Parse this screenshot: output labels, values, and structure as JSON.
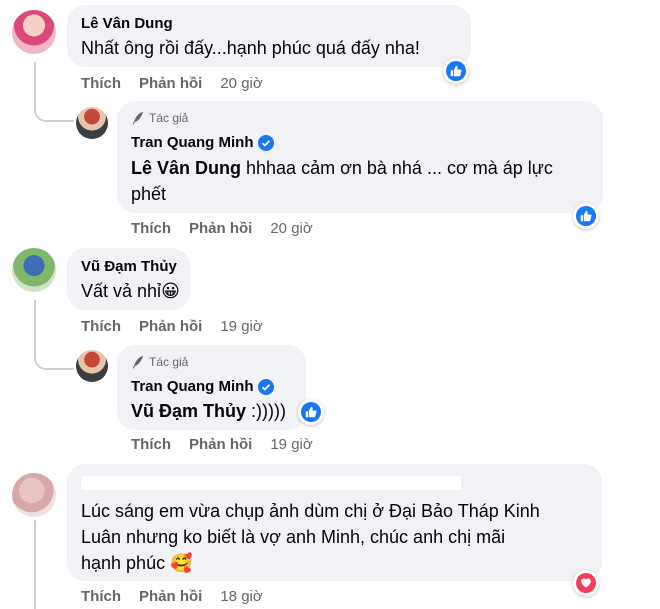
{
  "comments": [
    {
      "author": "Lê Vân Dung",
      "text": "Nhất ông rồi đấy...hạnh phúc quá đấy nha!",
      "like_label": "Thích",
      "reply_label": "Phản hồi",
      "time": "20 giờ",
      "reaction": "like-icon",
      "reply": {
        "badge": "Tác giả",
        "author": "Tran Quang Minh",
        "mention": "Lê Vân Dung",
        "text_line1": " hhhaa cảm ơn bà nhá ... cơ mà áp lực",
        "text_line2": "phết",
        "like_label": "Thích",
        "reply_label": "Phản hồi",
        "time": "20 giờ",
        "reaction": "like-icon"
      }
    },
    {
      "author": "Vũ Đạm Thủy",
      "text": "Vất vả nhỉ",
      "emoji": "😀",
      "like_label": "Thích",
      "reply_label": "Phản hồi",
      "time": "19 giờ",
      "reply": {
        "badge": "Tác giả",
        "author": "Tran Quang Minh",
        "mention": "Vũ Đạm Thủy",
        "text": " :)))))",
        "like_label": "Thích",
        "reply_label": "Phản hồi",
        "time": "19 giờ",
        "reaction": "like-icon"
      }
    },
    {
      "author": "",
      "text_line1": "Lúc sáng em vừa chụp ảnh dùm chị ở Đại Bảo Tháp Kinh",
      "text_line2": "Luân nhưng ko biết là vợ anh Minh, chúc anh chị mãi",
      "text_line3": "hạnh phúc",
      "emoji": "🥰",
      "like_label": "Thích",
      "reply_label": "Phản hồi",
      "time": "18 giờ",
      "reaction": "love-icon"
    }
  ],
  "colors": {
    "bubble": "#f0f2f5",
    "meta": "#65676b",
    "like_blue": "#1877f2",
    "love_red": "#f33e58",
    "thread_line": "#ced0d4"
  }
}
